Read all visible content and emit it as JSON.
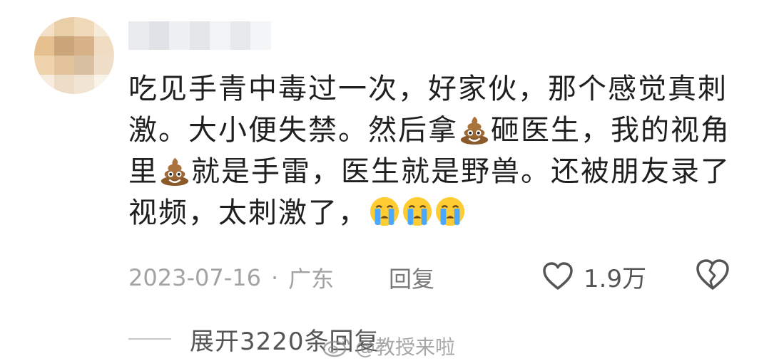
{
  "comment": {
    "segments": [
      {
        "type": "text",
        "value": "吃见手青中毒过一次，好家伙，那个感觉真刺激。大小便失禁。然后拿"
      },
      {
        "type": "emoji",
        "icon": "poop-emoji-icon"
      },
      {
        "type": "text",
        "value": "砸医生，我的视角里"
      },
      {
        "type": "emoji",
        "icon": "poop-emoji-icon"
      },
      {
        "type": "text",
        "value": "就是手雷，医生就是野兽。还被朋友录了视频，太刺激了，"
      },
      {
        "type": "emoji",
        "icon": "crying-face-emoji-icon"
      },
      {
        "type": "emoji",
        "icon": "crying-face-emoji-icon"
      },
      {
        "type": "emoji",
        "icon": "crying-face-emoji-icon"
      }
    ]
  },
  "meta": {
    "date": "2023-07-16",
    "separator": "·",
    "location": "广东",
    "reply_label": "回复"
  },
  "like": {
    "icon": "heart-outline-icon",
    "count": "1.9万"
  },
  "dislike": {
    "icon": "broken-heart-icon"
  },
  "expand": {
    "label": "展开3220条回复"
  },
  "watermark": {
    "icon": "weibo-logo-icon",
    "text": "@教授来啦"
  },
  "colors": {
    "text": "#1f1f1f",
    "meta": "#a3a3a3",
    "poop": "#8b5a2b",
    "cry_face": "#ffcc33",
    "tears": "#4aa8ff"
  }
}
